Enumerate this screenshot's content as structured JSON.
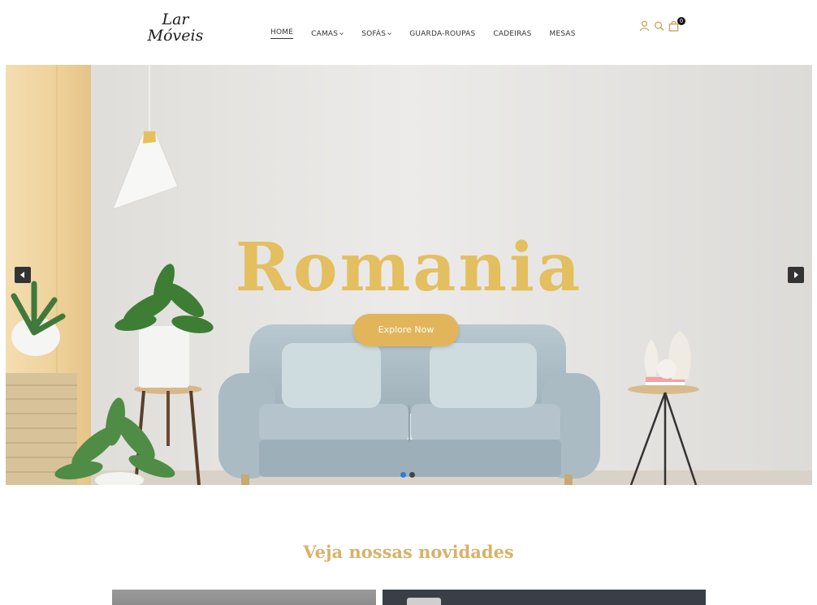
{
  "brand": {
    "line1": "Lar",
    "line2": "Móveis"
  },
  "nav": {
    "items": [
      {
        "label": "HOME",
        "active": true,
        "dropdown": false
      },
      {
        "label": "CAMAS",
        "active": false,
        "dropdown": true
      },
      {
        "label": "SOFÁS",
        "active": false,
        "dropdown": true
      },
      {
        "label": "GUARDA-ROUPAS",
        "active": false,
        "dropdown": false
      },
      {
        "label": "CADEIRAS",
        "active": false,
        "dropdown": false
      },
      {
        "label": "MESAS",
        "active": false,
        "dropdown": false
      }
    ]
  },
  "header_icons": {
    "account": "user-icon",
    "search": "search-icon",
    "cart": "cart-icon",
    "cart_count": "0"
  },
  "hero": {
    "title": "Romania",
    "cta_label": "Explore Now",
    "slides_total": 2,
    "active_slide": 1
  },
  "section": {
    "title": "Veja nossas novidades"
  },
  "colors": {
    "accent": "#e3b55a",
    "title_gold": "#e3bf60",
    "section_gold": "#d8b26a",
    "dot_active": "#2a7fd4"
  }
}
